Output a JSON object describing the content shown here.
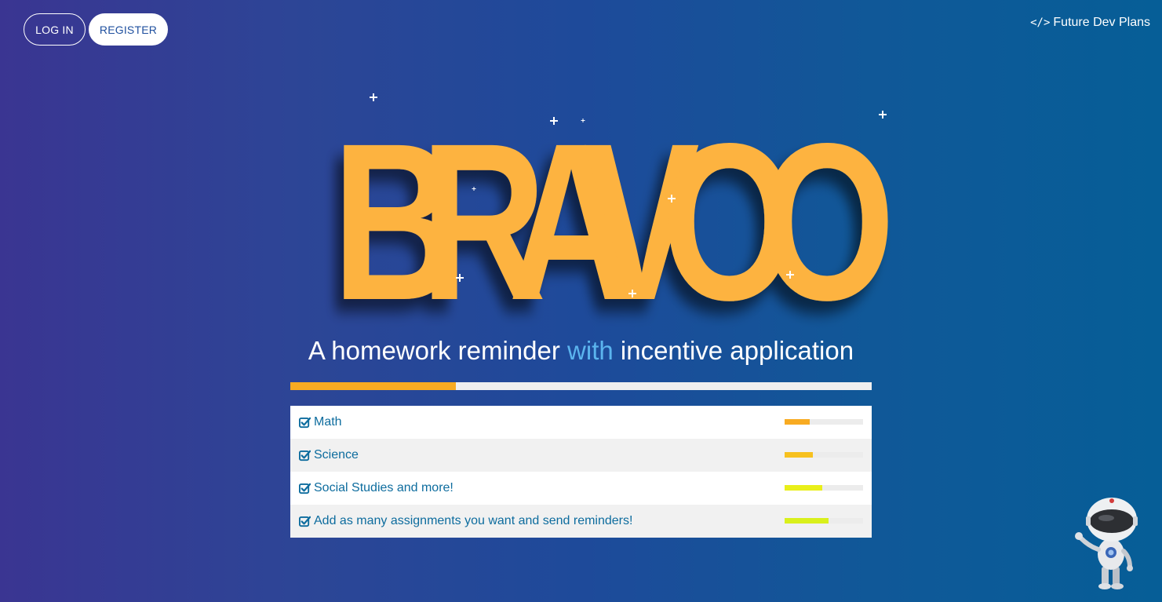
{
  "header": {
    "login_label": "LOG IN",
    "register_label": "REGISTER",
    "dev_plans_label": "Future Dev Plans",
    "dev_plans_icon": "code-icon"
  },
  "hero": {
    "logo_text": "BRAVOO",
    "logo_letters": [
      "B",
      "R",
      "A",
      "V",
      "O",
      "O"
    ],
    "logo_color": "#fdb341",
    "tagline_before": "A homework reminder ",
    "tagline_highlight": "with",
    "tagline_after": " incentive application",
    "tagline_highlight_color": "#5bb4ee",
    "progress_percent": 28.5,
    "progress_color": "#f8ab22"
  },
  "features": [
    {
      "label": "Math",
      "icon": "check-square-icon",
      "progress_percent": 32,
      "bar_color": "#f8ab22"
    },
    {
      "label": "Science",
      "icon": "check-square-icon",
      "progress_percent": 36,
      "bar_color": "#f7c11f"
    },
    {
      "label": "Social Studies and more!",
      "icon": "check-square-icon",
      "progress_percent": 48,
      "bar_color": "#e9ef1a"
    },
    {
      "label": "Add as many assignments you want and send reminders!",
      "icon": "check-square-icon",
      "progress_percent": 56,
      "bar_color": "#d9f01c"
    }
  ],
  "mascot": {
    "icon": "robot-icon"
  }
}
